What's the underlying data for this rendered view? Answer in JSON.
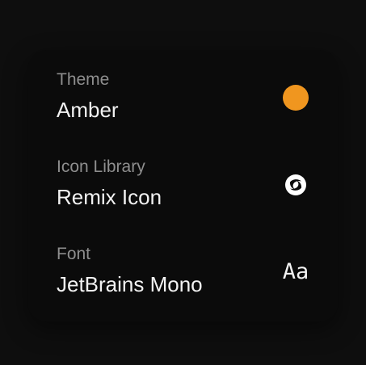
{
  "settings": {
    "theme": {
      "label": "Theme",
      "value": "Amber",
      "swatch_color": "#f0961f"
    },
    "icon_library": {
      "label": "Icon Library",
      "value": "Remix Icon",
      "icon": "remix-icon-logo"
    },
    "font": {
      "label": "Font",
      "value": "JetBrains Mono",
      "sample": "Aa"
    }
  }
}
